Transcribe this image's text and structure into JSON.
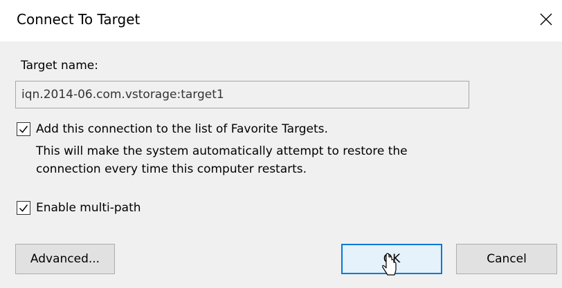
{
  "window": {
    "title": "Connect To Target",
    "close_icon": "close-icon"
  },
  "target": {
    "label": "Target name:",
    "value": "iqn.2014-06.com.vstorage:target1"
  },
  "favorites": {
    "checked": true,
    "label": "Add this connection to the list of Favorite Targets.",
    "description_line1": "This will make the system automatically attempt to restore the",
    "description_line2": "connection every time this computer restarts."
  },
  "multipath": {
    "checked": true,
    "label": "Enable multi-path"
  },
  "buttons": {
    "advanced": "Advanced...",
    "ok": "OK",
    "cancel": "Cancel"
  },
  "colors": {
    "dialog_bg": "#f0f0f0",
    "titlebar_bg": "#ffffff",
    "default_button_border": "#0078d7",
    "default_button_bg": "#e5f1fb"
  },
  "cursor": "hand-pointer-icon"
}
